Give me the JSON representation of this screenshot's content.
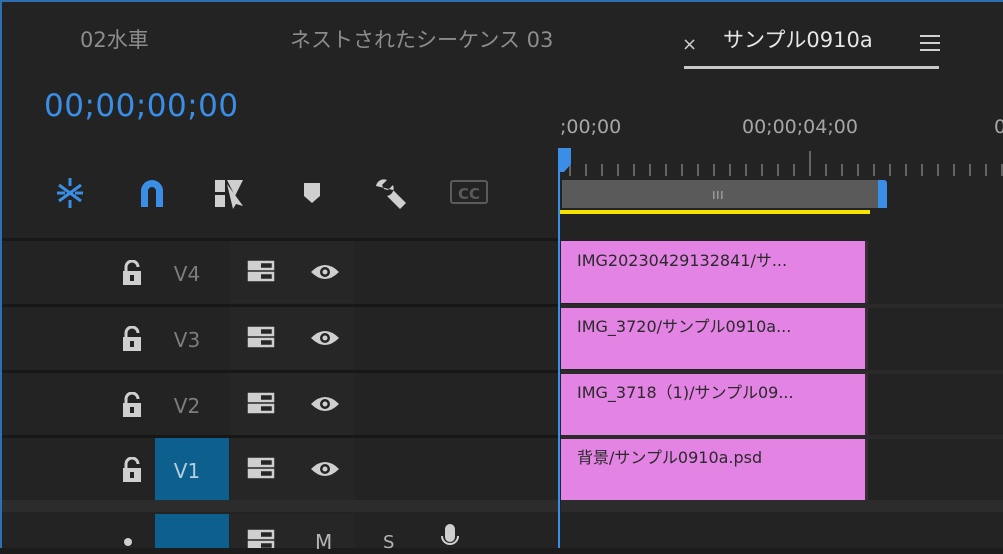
{
  "tabs": [
    {
      "label": "02水車"
    },
    {
      "label": "ネストされたシーケンス 03"
    },
    {
      "label": "サンプル0910a",
      "close": "×",
      "active": true
    }
  ],
  "timecode": "00;00;00;00",
  "toolbar": {
    "icons": [
      "snap-nest-icon",
      "magnet-icon",
      "linked-selection-icon",
      "marker-icon",
      "wrench-icon",
      "captions-icon"
    ],
    "cc_label": "CC",
    "accent": "#3a8ee6"
  },
  "ruler": {
    "labels": [
      ";00;00",
      "00;00;04;00",
      "0"
    ],
    "playhead_color": "#3a8ee6",
    "work_area_color": "#f5e400"
  },
  "tracks": [
    {
      "name": "V4",
      "clip": "IMG20230429132841/サ..."
    },
    {
      "name": "V3",
      "clip": "IMG_3720/サンプル0910a..."
    },
    {
      "name": "V2",
      "clip": "IMG_3718（1)/サンプル09..."
    },
    {
      "name": "V1",
      "clip": "背景/サンプル0910a.psd",
      "targeted": true
    }
  ],
  "audio_track": {
    "mute": "M",
    "solo": "S"
  },
  "clip_color": "#e383e3"
}
